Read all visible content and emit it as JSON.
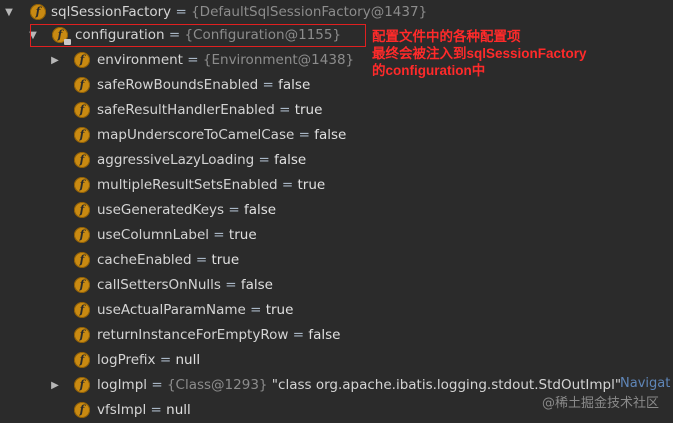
{
  "tree": {
    "root": {
      "name": "sqlSessionFactory",
      "eq": " = ",
      "ref": "{DefaultSqlSessionFactory@1437}"
    },
    "config": {
      "name": "configuration",
      "eq": " = ",
      "ref": "{Configuration@1155}"
    },
    "children": [
      {
        "name": "environment",
        "eq": " = ",
        "ref": "{Environment@1438}",
        "val": ""
      },
      {
        "name": "safeRowBoundsEnabled",
        "eq": " = ",
        "val": "false"
      },
      {
        "name": "safeResultHandlerEnabled",
        "eq": " = ",
        "val": "true"
      },
      {
        "name": "mapUnderscoreToCamelCase",
        "eq": " = ",
        "val": "false"
      },
      {
        "name": "aggressiveLazyLoading",
        "eq": " = ",
        "val": "false"
      },
      {
        "name": "multipleResultSetsEnabled",
        "eq": " = ",
        "val": "true"
      },
      {
        "name": "useGeneratedKeys",
        "eq": " = ",
        "val": "false"
      },
      {
        "name": "useColumnLabel",
        "eq": " = ",
        "val": "true"
      },
      {
        "name": "cacheEnabled",
        "eq": " = ",
        "val": "true"
      },
      {
        "name": "callSettersOnNulls",
        "eq": " = ",
        "val": "false"
      },
      {
        "name": "useActualParamName",
        "eq": " = ",
        "val": "true"
      },
      {
        "name": "returnInstanceForEmptyRow",
        "eq": " = ",
        "val": "false"
      },
      {
        "name": "logPrefix",
        "eq": " = ",
        "val": "null"
      },
      {
        "name": "logImpl",
        "eq": " = ",
        "ref": "{Class@1293}",
        "val": " \"class org.apache.ibatis.logging.stdout.StdOutImpl\""
      },
      {
        "name": "vfsImpl",
        "eq": " = ",
        "val": "null"
      }
    ]
  },
  "annotation": {
    "line1": "配置文件中的各种配置项",
    "line2": "最终会被注入到sqlSessionFactory",
    "line3": "的configuration中"
  },
  "navigate_label": "Navigat",
  "watermark": "@稀土掘金技术社区",
  "icon_letter": "f"
}
